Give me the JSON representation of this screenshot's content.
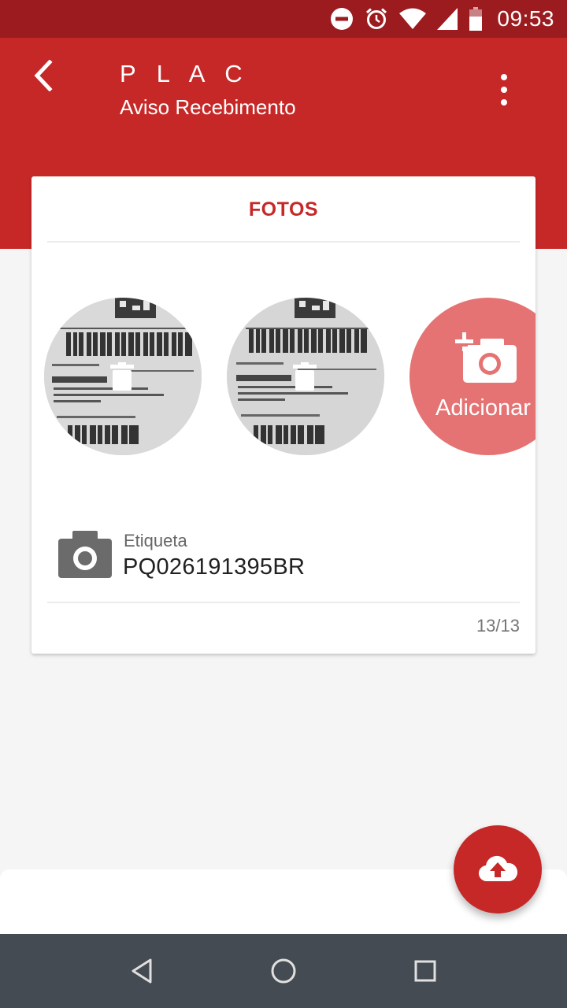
{
  "status_bar": {
    "time": "09:53",
    "icons": [
      "do-not-disturb-icon",
      "alarm-icon",
      "wifi-icon",
      "signal-icon",
      "battery-icon"
    ]
  },
  "app_bar": {
    "title": "P L A C",
    "subtitle": "Aviso Recebimento",
    "back_icon": "back-arrow-icon",
    "menu_icon": "more-vert-icon",
    "color": "#c62828"
  },
  "card": {
    "header": "FOTOS",
    "photos": [
      {
        "delete_icon": "trash-icon"
      },
      {
        "delete_icon": "trash-icon"
      }
    ],
    "add_photo": {
      "label": "Adicionar",
      "icon": "add-photo-icon"
    },
    "label_field": {
      "caption": "Etiqueta",
      "value": "PQ026191395BR",
      "icon": "camera-icon"
    },
    "counter": "13/13"
  },
  "fab": {
    "icon": "cloud-upload-icon"
  },
  "nav_bar": {
    "icons": [
      "nav-back-icon",
      "nav-home-icon",
      "nav-recents-icon"
    ]
  },
  "colors": {
    "primary": "#c62828",
    "status_bar": "#9b1b1f",
    "add_button": "#e57373",
    "nav_bar": "#454b53"
  }
}
